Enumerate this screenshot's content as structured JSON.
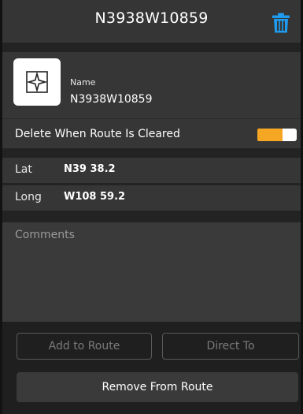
{
  "header": {
    "title": "N3938W10859",
    "delete_icon": "trash-icon",
    "delete_icon_color": "#1e9bf0"
  },
  "waypoint": {
    "icon": "waypoint-star-icon",
    "name_label": "Name",
    "name_value": "N3938W10859"
  },
  "settings": {
    "delete_when_cleared_label": "Delete When Route Is Cleared",
    "delete_when_cleared_on": true,
    "toggle_color": "#f5a623"
  },
  "coordinates": {
    "lat_label": "Lat",
    "lat_value": "N39 38.2",
    "long_label": "Long",
    "long_value": "W108 59.2"
  },
  "comments": {
    "placeholder": "Comments",
    "value": ""
  },
  "actions": {
    "add_to_route": "Add to Route",
    "direct_to": "Direct To",
    "remove_from_route": "Remove From Route"
  }
}
